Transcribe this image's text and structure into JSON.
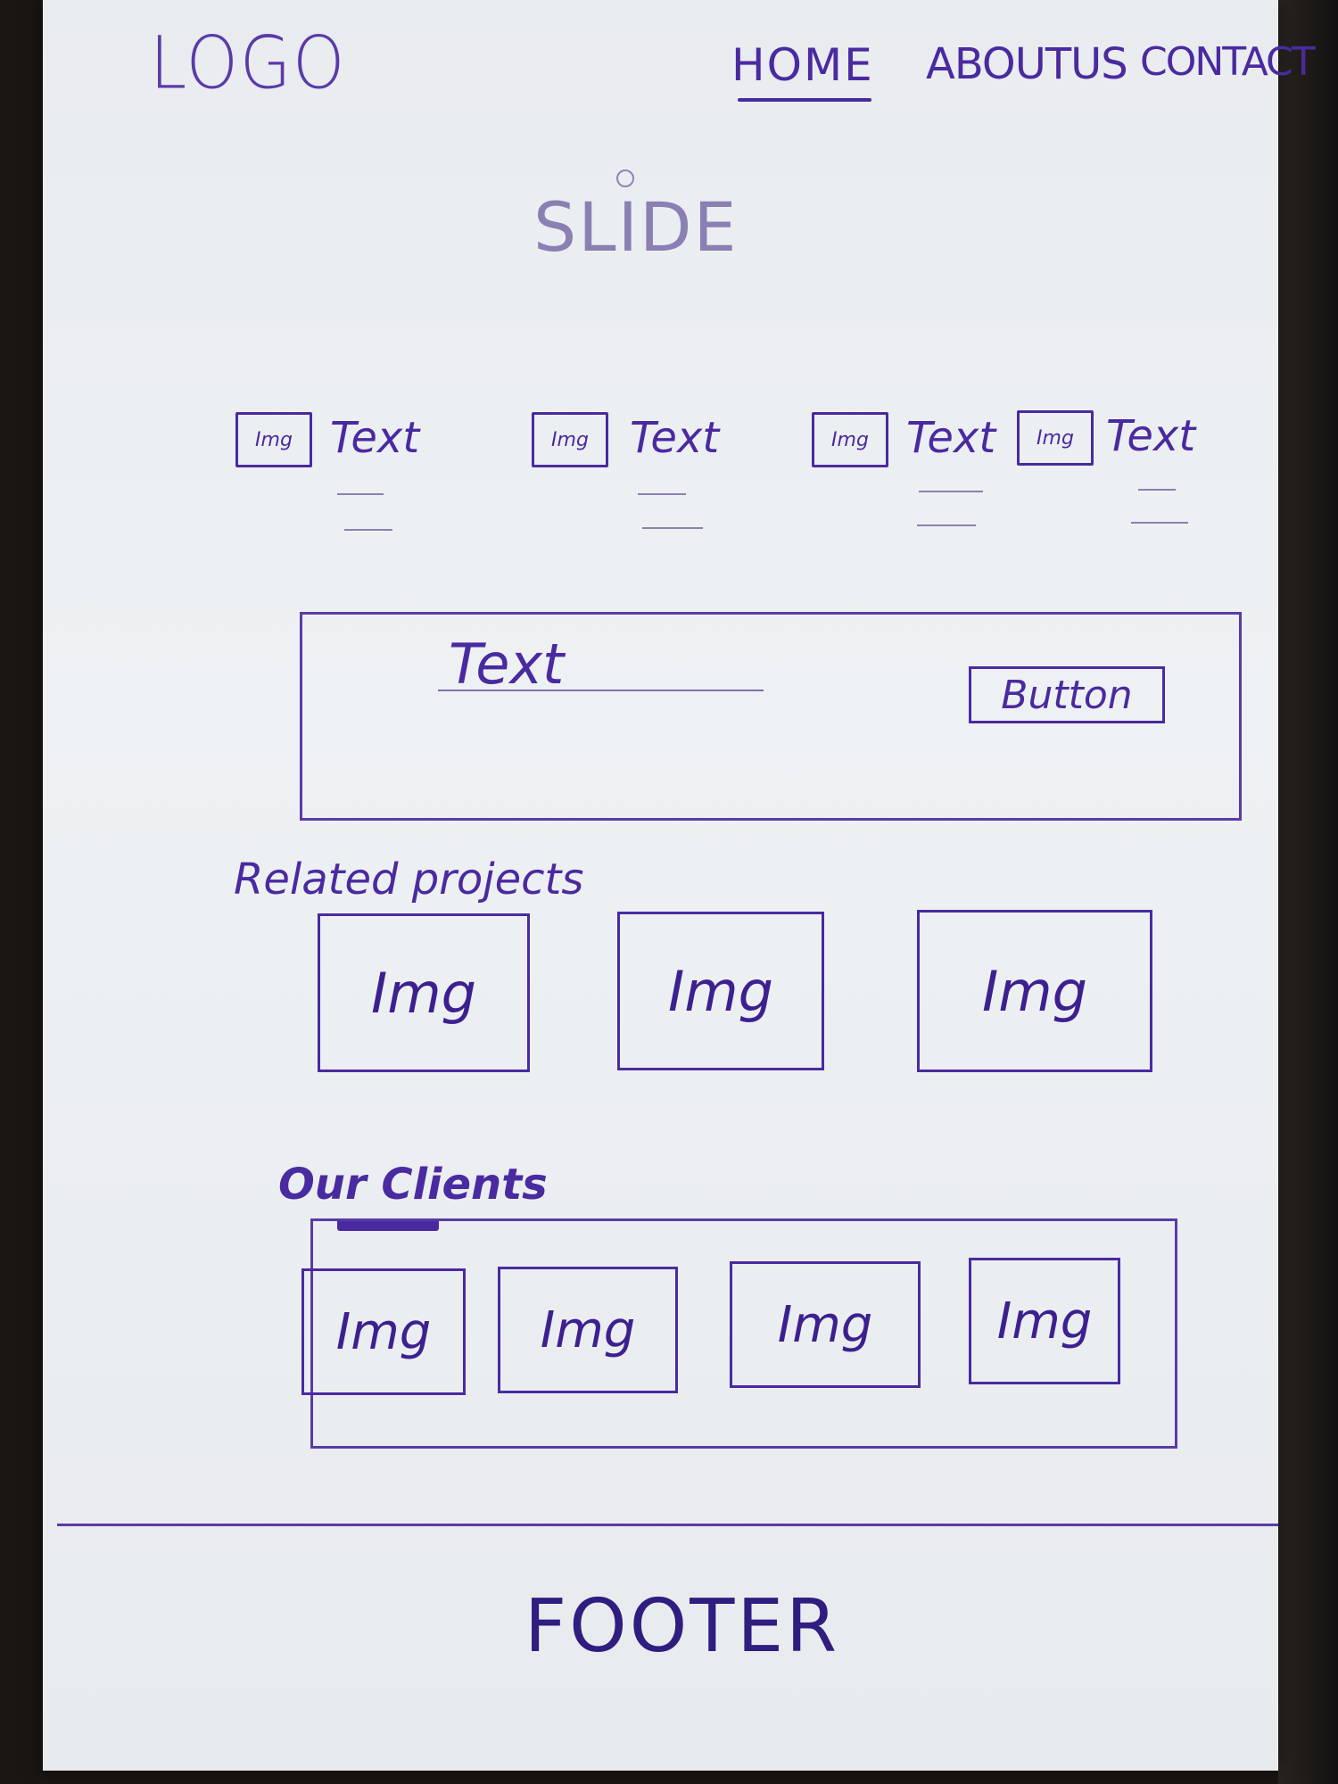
{
  "header": {
    "logo": "LOGO",
    "nav": {
      "home": "HOME",
      "about": "ABOUTUS",
      "contact": "CONTACT"
    }
  },
  "slider": {
    "label": "SLIDE"
  },
  "features": [
    {
      "img": "Img",
      "text": "Text"
    },
    {
      "img": "Img",
      "text": "Text"
    },
    {
      "img": "Img",
      "text": "Text"
    },
    {
      "img": "Img",
      "text": "Text"
    }
  ],
  "cta": {
    "text": "Text",
    "button": "Button"
  },
  "related_projects": {
    "title": "Related projects",
    "items": [
      "Img",
      "Img",
      "Img"
    ]
  },
  "clients": {
    "title": "Our Clients",
    "items": [
      "Img",
      "Img",
      "Img",
      "Img"
    ]
  },
  "footer": {
    "label": "FOOTER"
  },
  "colors": {
    "ink": "#4a2aa0",
    "paper": "#e9ecef"
  }
}
